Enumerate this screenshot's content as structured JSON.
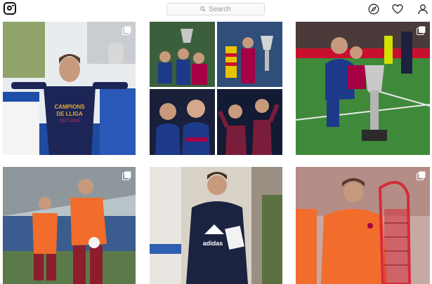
{
  "header": {
    "search": {
      "placeholder": "Search"
    },
    "icons": [
      "instagram-logo-icon",
      "search-icon",
      "compass-icon",
      "heart-icon",
      "profile-icon"
    ]
  },
  "posts": [
    {
      "shirt_text": "CAMPIONS DE LLIGA 2017-2018",
      "multi": true
    },
    {
      "multi": false
    },
    {
      "multi": true
    },
    {
      "multi": true
    },
    {
      "multi": false
    },
    {
      "multi": true
    }
  ],
  "colors": {
    "barca_blue": "#1d3a8a",
    "barca_red": "#a50044",
    "orange_kit": "#f26c2b",
    "pitch_green": "#3f8a3a",
    "navy": "#1b2340"
  }
}
